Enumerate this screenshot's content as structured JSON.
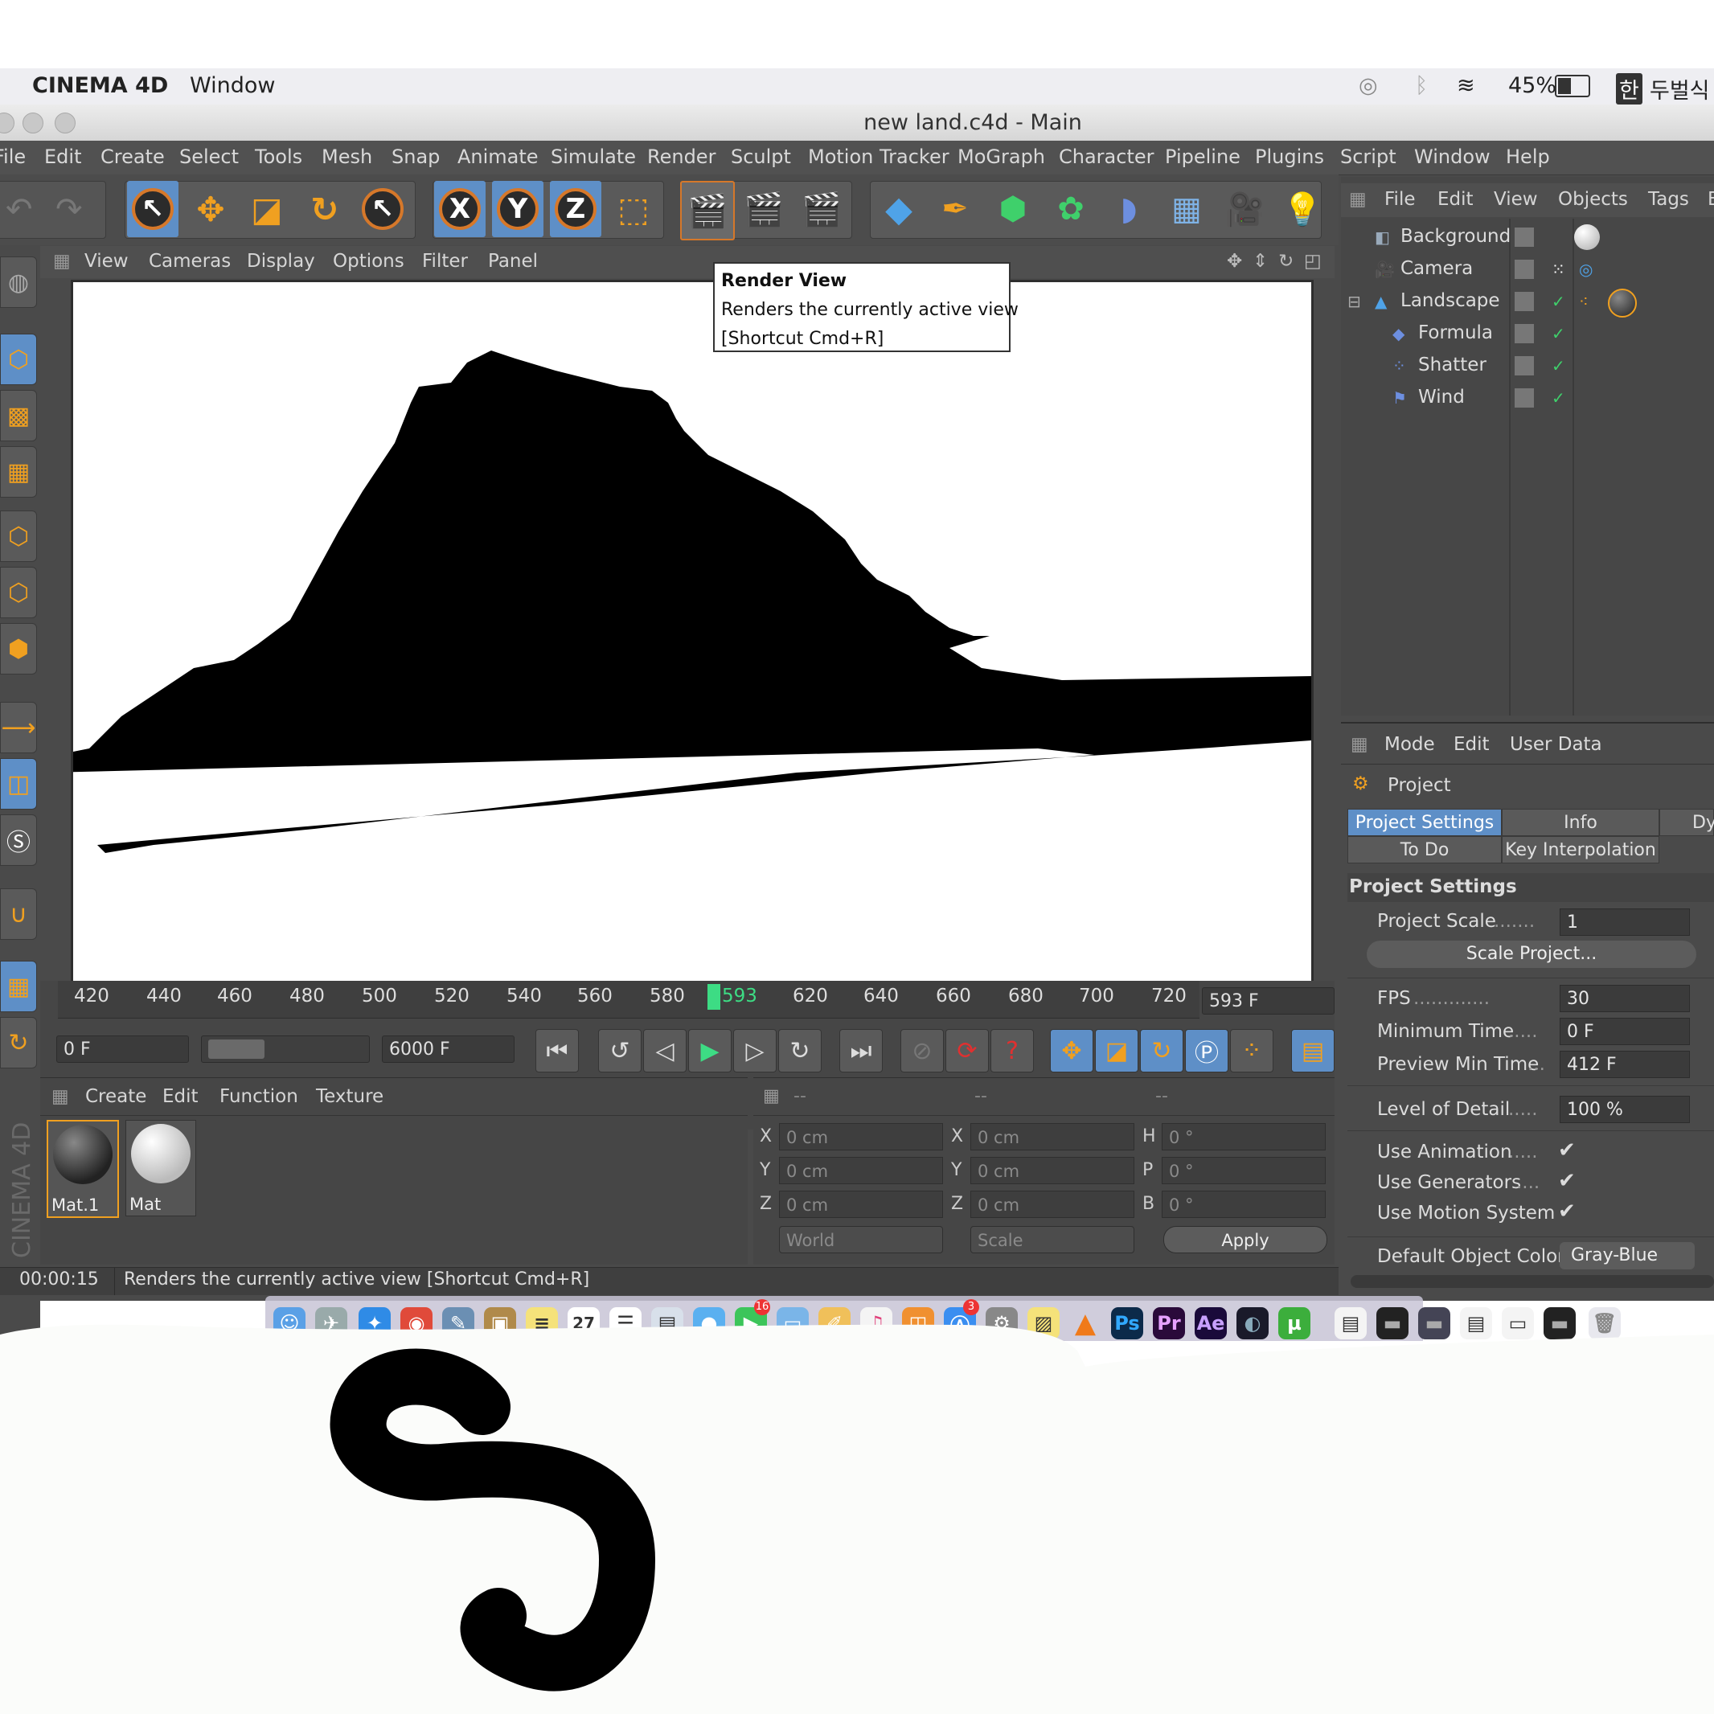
{
  "menubar": {
    "app_name": "CINEMA 4D",
    "window_menu": "Window",
    "battery": "45%",
    "input_method_icon": "한",
    "input_method_label": "두벌식"
  },
  "window": {
    "title": "new land.c4d - Main"
  },
  "app_menu": [
    "File",
    "Edit",
    "Create",
    "Select",
    "Tools",
    "Mesh",
    "Snap",
    "Animate",
    "Simulate",
    "Render",
    "Sculpt",
    "Motion Tracker",
    "MoGraph",
    "Character",
    "Pipeline",
    "Plugins",
    "Script",
    "Window",
    "Help"
  ],
  "viewport_menu": [
    "View",
    "Cameras",
    "Display",
    "Options",
    "Filter",
    "Panel"
  ],
  "tooltip": {
    "title": "Render View",
    "description": "Renders the currently active view",
    "shortcut": "[Shortcut Cmd+R]"
  },
  "timeline": {
    "ticks": [
      "420",
      "440",
      "460",
      "480",
      "500",
      "520",
      "540",
      "560",
      "580",
      "593",
      "620",
      "640",
      "660",
      "680",
      "700",
      "720"
    ],
    "current_frame": "593",
    "frame_field": "593 F",
    "start_field": "0 F",
    "end_field": "6000 F"
  },
  "material_manager": {
    "menu": [
      "Create",
      "Edit",
      "Function",
      "Texture"
    ],
    "materials": [
      "Mat.1",
      "Mat"
    ],
    "brand": "CINEMA 4D"
  },
  "coordinates": {
    "header": [
      "--",
      "--",
      "--"
    ],
    "rows": [
      {
        "l1": "X",
        "v1": "0 cm",
        "l2": "X",
        "v2": "0 cm",
        "l3": "H",
        "v3": "0 °"
      },
      {
        "l1": "Y",
        "v1": "0 cm",
        "l2": "Y",
        "v2": "0 cm",
        "l3": "P",
        "v3": "0 °"
      },
      {
        "l1": "Z",
        "v1": "0 cm",
        "l2": "Z",
        "v2": "0 cm",
        "l3": "B",
        "v3": "0 °"
      }
    ],
    "space_select": "World",
    "mode_select": "Scale",
    "apply_label": "Apply"
  },
  "status_bar": {
    "time": "00:00:15",
    "message": "Renders the currently active view [Shortcut Cmd+R]"
  },
  "object_manager": {
    "menu": [
      "File",
      "Edit",
      "View",
      "Objects",
      "Tags",
      "B"
    ],
    "objects": [
      {
        "name": "Background",
        "icon": "background-icon"
      },
      {
        "name": "Camera",
        "icon": "camera-icon"
      },
      {
        "name": "Landscape",
        "icon": "landscape-icon"
      },
      {
        "name": "Formula",
        "icon": "formula-icon"
      },
      {
        "name": "Shatter",
        "icon": "shatter-icon"
      },
      {
        "name": "Wind",
        "icon": "wind-icon"
      }
    ]
  },
  "attribute_manager": {
    "menu": [
      "Mode",
      "Edit",
      "User Data"
    ],
    "object_label": "Project",
    "tabs": [
      "Project Settings",
      "Info",
      "Dy",
      "To Do",
      "Key Interpolation"
    ],
    "section_title": "Project Settings",
    "project_scale_label": "Project Scale",
    "project_scale_value": "1",
    "scale_project_button": "Scale Project...",
    "fps_label": "FPS",
    "fps_value": "30",
    "min_time_label": "Minimum Time",
    "min_time_value": "0 F",
    "preview_min_label": "Preview Min Time",
    "preview_min_value": "412 F",
    "lod_label": "Level of Detail",
    "lod_value": "100 %",
    "use_animation_label": "Use Animation",
    "use_generators_label": "Use Generators",
    "use_motion_label": "Use Motion System",
    "default_color_label": "Default Object Color",
    "default_color_value": "Gray-Blue"
  },
  "dock": {
    "apps": [
      "Ps",
      "Pr",
      "Ae"
    ],
    "badge_messages": "16",
    "badge_appstore": "3",
    "calendar_day": "27"
  },
  "colors": {
    "panel_bg": "#4a4a4a",
    "accent_orange": "#f0a020",
    "selection_blue": "#5e8fc7",
    "timeline_marker": "#3ddc84",
    "render_silhouette": "#000000"
  }
}
